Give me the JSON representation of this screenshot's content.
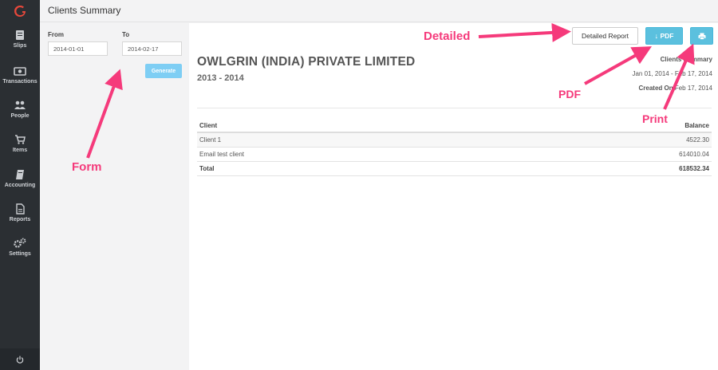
{
  "app": {
    "title": "Clients Summary"
  },
  "sidebar": {
    "items": [
      {
        "label": "Slips",
        "icon": "slips-icon"
      },
      {
        "label": "Transactions",
        "icon": "money-icon"
      },
      {
        "label": "People",
        "icon": "people-icon"
      },
      {
        "label": "Items",
        "icon": "cart-icon"
      },
      {
        "label": "Accounting",
        "icon": "book-icon"
      },
      {
        "label": "Reports",
        "icon": "document-icon"
      },
      {
        "label": "Settings",
        "icon": "gears-icon"
      }
    ]
  },
  "form": {
    "from_label": "From",
    "from_value": "2014-01-01",
    "to_label": "To",
    "to_value": "2014-02-17",
    "generate_label": "Generate"
  },
  "toolbar": {
    "detailed_label": "Detailed Report",
    "pdf_label": "PDF"
  },
  "report": {
    "company": "OWLGRIN (INDIA) PRIVATE LIMITED",
    "period": "2013 - 2014",
    "title": "Clients Summary",
    "range": "Jan 01, 2014 - Feb 17, 2014",
    "created_label": "Created On",
    "created_value": "Feb 17, 2014",
    "columns": [
      "Client",
      "Balance"
    ],
    "rows": [
      {
        "client": "Client 1",
        "balance": "4522.30"
      },
      {
        "client": "Email test client",
        "balance": "614010.04"
      }
    ],
    "total_label": "Total",
    "total_value": "618532.34"
  },
  "annotations": {
    "detailed": "Detailed",
    "pdf": "PDF",
    "print": "Print",
    "form": "Form",
    "color": "#f53a7b"
  },
  "colors": {
    "sidebar": "#2b2f33",
    "accent": "#5bc0de",
    "generate": "#7ecef4",
    "logo": "#e8483b"
  }
}
